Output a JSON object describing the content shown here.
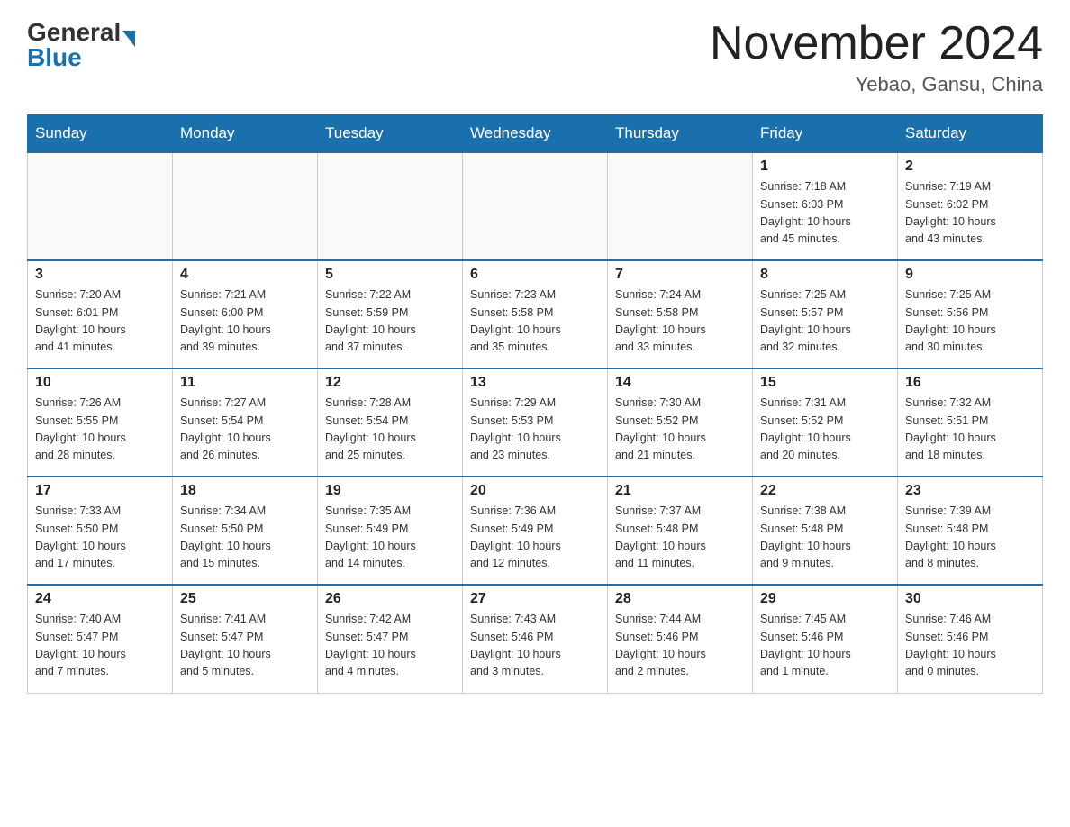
{
  "header": {
    "logo_general": "General",
    "logo_blue": "Blue",
    "month_title": "November 2024",
    "location": "Yebao, Gansu, China"
  },
  "weekdays": [
    "Sunday",
    "Monday",
    "Tuesday",
    "Wednesday",
    "Thursday",
    "Friday",
    "Saturday"
  ],
  "weeks": [
    [
      {
        "day": "",
        "info": ""
      },
      {
        "day": "",
        "info": ""
      },
      {
        "day": "",
        "info": ""
      },
      {
        "day": "",
        "info": ""
      },
      {
        "day": "",
        "info": ""
      },
      {
        "day": "1",
        "info": "Sunrise: 7:18 AM\nSunset: 6:03 PM\nDaylight: 10 hours\nand 45 minutes."
      },
      {
        "day": "2",
        "info": "Sunrise: 7:19 AM\nSunset: 6:02 PM\nDaylight: 10 hours\nand 43 minutes."
      }
    ],
    [
      {
        "day": "3",
        "info": "Sunrise: 7:20 AM\nSunset: 6:01 PM\nDaylight: 10 hours\nand 41 minutes."
      },
      {
        "day": "4",
        "info": "Sunrise: 7:21 AM\nSunset: 6:00 PM\nDaylight: 10 hours\nand 39 minutes."
      },
      {
        "day": "5",
        "info": "Sunrise: 7:22 AM\nSunset: 5:59 PM\nDaylight: 10 hours\nand 37 minutes."
      },
      {
        "day": "6",
        "info": "Sunrise: 7:23 AM\nSunset: 5:58 PM\nDaylight: 10 hours\nand 35 minutes."
      },
      {
        "day": "7",
        "info": "Sunrise: 7:24 AM\nSunset: 5:58 PM\nDaylight: 10 hours\nand 33 minutes."
      },
      {
        "day": "8",
        "info": "Sunrise: 7:25 AM\nSunset: 5:57 PM\nDaylight: 10 hours\nand 32 minutes."
      },
      {
        "day": "9",
        "info": "Sunrise: 7:25 AM\nSunset: 5:56 PM\nDaylight: 10 hours\nand 30 minutes."
      }
    ],
    [
      {
        "day": "10",
        "info": "Sunrise: 7:26 AM\nSunset: 5:55 PM\nDaylight: 10 hours\nand 28 minutes."
      },
      {
        "day": "11",
        "info": "Sunrise: 7:27 AM\nSunset: 5:54 PM\nDaylight: 10 hours\nand 26 minutes."
      },
      {
        "day": "12",
        "info": "Sunrise: 7:28 AM\nSunset: 5:54 PM\nDaylight: 10 hours\nand 25 minutes."
      },
      {
        "day": "13",
        "info": "Sunrise: 7:29 AM\nSunset: 5:53 PM\nDaylight: 10 hours\nand 23 minutes."
      },
      {
        "day": "14",
        "info": "Sunrise: 7:30 AM\nSunset: 5:52 PM\nDaylight: 10 hours\nand 21 minutes."
      },
      {
        "day": "15",
        "info": "Sunrise: 7:31 AM\nSunset: 5:52 PM\nDaylight: 10 hours\nand 20 minutes."
      },
      {
        "day": "16",
        "info": "Sunrise: 7:32 AM\nSunset: 5:51 PM\nDaylight: 10 hours\nand 18 minutes."
      }
    ],
    [
      {
        "day": "17",
        "info": "Sunrise: 7:33 AM\nSunset: 5:50 PM\nDaylight: 10 hours\nand 17 minutes."
      },
      {
        "day": "18",
        "info": "Sunrise: 7:34 AM\nSunset: 5:50 PM\nDaylight: 10 hours\nand 15 minutes."
      },
      {
        "day": "19",
        "info": "Sunrise: 7:35 AM\nSunset: 5:49 PM\nDaylight: 10 hours\nand 14 minutes."
      },
      {
        "day": "20",
        "info": "Sunrise: 7:36 AM\nSunset: 5:49 PM\nDaylight: 10 hours\nand 12 minutes."
      },
      {
        "day": "21",
        "info": "Sunrise: 7:37 AM\nSunset: 5:48 PM\nDaylight: 10 hours\nand 11 minutes."
      },
      {
        "day": "22",
        "info": "Sunrise: 7:38 AM\nSunset: 5:48 PM\nDaylight: 10 hours\nand 9 minutes."
      },
      {
        "day": "23",
        "info": "Sunrise: 7:39 AM\nSunset: 5:48 PM\nDaylight: 10 hours\nand 8 minutes."
      }
    ],
    [
      {
        "day": "24",
        "info": "Sunrise: 7:40 AM\nSunset: 5:47 PM\nDaylight: 10 hours\nand 7 minutes."
      },
      {
        "day": "25",
        "info": "Sunrise: 7:41 AM\nSunset: 5:47 PM\nDaylight: 10 hours\nand 5 minutes."
      },
      {
        "day": "26",
        "info": "Sunrise: 7:42 AM\nSunset: 5:47 PM\nDaylight: 10 hours\nand 4 minutes."
      },
      {
        "day": "27",
        "info": "Sunrise: 7:43 AM\nSunset: 5:46 PM\nDaylight: 10 hours\nand 3 minutes."
      },
      {
        "day": "28",
        "info": "Sunrise: 7:44 AM\nSunset: 5:46 PM\nDaylight: 10 hours\nand 2 minutes."
      },
      {
        "day": "29",
        "info": "Sunrise: 7:45 AM\nSunset: 5:46 PM\nDaylight: 10 hours\nand 1 minute."
      },
      {
        "day": "30",
        "info": "Sunrise: 7:46 AM\nSunset: 5:46 PM\nDaylight: 10 hours\nand 0 minutes."
      }
    ]
  ]
}
